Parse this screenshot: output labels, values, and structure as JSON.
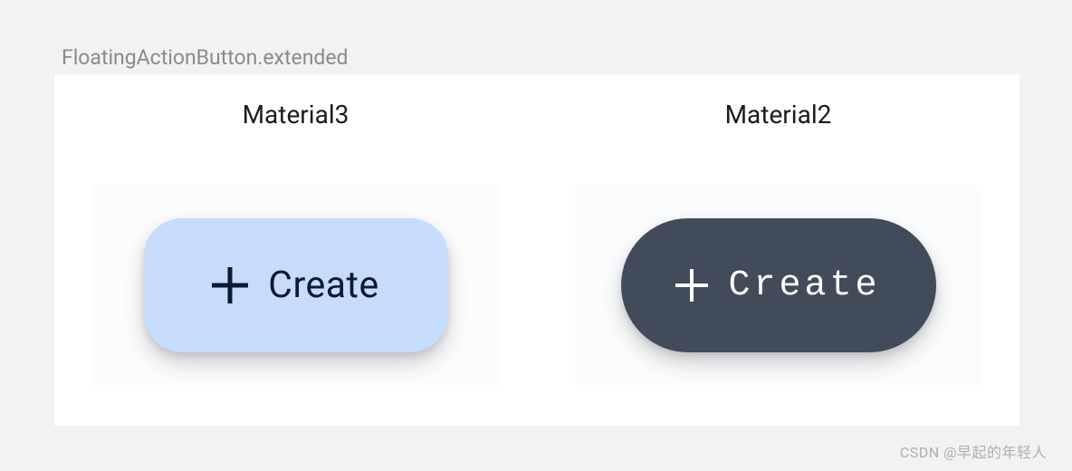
{
  "title": "FloatingActionButton.extended",
  "columns": [
    {
      "heading": "Material3",
      "fab": {
        "icon": "plus-icon",
        "label": "Create",
        "variant": "m3",
        "bg_color": "#c7dbfb",
        "fg_color": "#0b1b32"
      }
    },
    {
      "heading": "Material2",
      "fab": {
        "icon": "plus-icon",
        "label": "Create",
        "variant": "m2",
        "bg_color": "#414b5a",
        "fg_color": "#ffffff"
      }
    }
  ],
  "watermark": "CSDN @早起的年轻人"
}
